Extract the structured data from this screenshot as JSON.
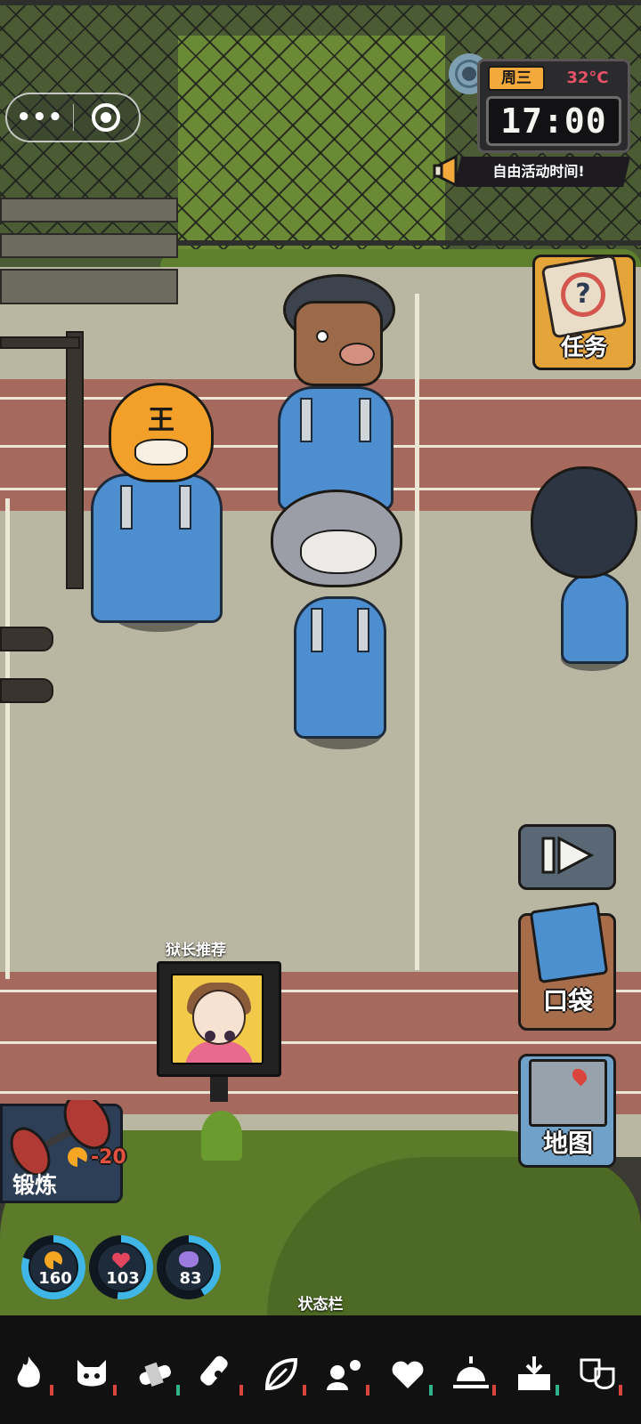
{
  "mini_program": {
    "menu_icon": "more-dots-icon",
    "menu_label": "•••",
    "close_icon": "target-circle-icon"
  },
  "clock": {
    "day": "周三",
    "temperature": "32°C",
    "time": "17:00",
    "settings_icon": "gear-icon"
  },
  "announcement": {
    "icon": "megaphone-icon",
    "text": "自由活动时间!"
  },
  "side_buttons": {
    "quest": {
      "label": "任务",
      "icon": "clipboard-question-icon"
    },
    "fast_forward": {
      "icon": "fast-forward-icon"
    },
    "pocket": {
      "label": "口袋",
      "icon": "pocket-card-icon"
    },
    "map": {
      "label": "地图",
      "icon": "map-icon"
    }
  },
  "recommendation": {
    "title": "狱长推荐",
    "icon": "recommended-game-art"
  },
  "exercise": {
    "label": "锻炼",
    "cost": "-20",
    "icon": "dumbbell-icon",
    "cost_icon": "stamina-icon"
  },
  "stats": [
    {
      "name": "stamina",
      "icon": "stamina-icon",
      "value": "160",
      "level": 0.8,
      "color": "#3fb6e6"
    },
    {
      "name": "health",
      "icon": "heart-icon",
      "value": "103",
      "level": 0.52,
      "color": "#3fb6e6"
    },
    {
      "name": "brain",
      "icon": "brain-icon",
      "value": "83",
      "level": 0.42,
      "color": "#3fb6e6"
    }
  ],
  "status_bar": {
    "title": "状态栏",
    "items": [
      {
        "icon": "fire-icon",
        "mark_color": "#d9443b"
      },
      {
        "icon": "cat-mask-icon",
        "mark_color": "#d9443b"
      },
      {
        "icon": "bandage-icon",
        "mark_color": "#2fb38a"
      },
      {
        "icon": "plaster-icon",
        "mark_color": "#d9443b"
      },
      {
        "icon": "leaf-icon",
        "mark_color": "#d9443b"
      },
      {
        "icon": "sun-person-icon",
        "mark_color": "#d9443b"
      },
      {
        "icon": "heart-hands-icon",
        "mark_color": "#2fb38a"
      },
      {
        "icon": "sunrise-icon",
        "mark_color": "#d9443b"
      },
      {
        "icon": "download-box-icon",
        "mark_color": "#2fb38a"
      },
      {
        "icon": "theater-masks-icon",
        "mark_color": "#d9443b"
      }
    ]
  },
  "characters": [
    {
      "name": "tiger-mask-inmate",
      "mask_text": "王"
    },
    {
      "name": "pig-mask-inmate"
    },
    {
      "name": "wolf-mask-inmate"
    },
    {
      "name": "shadow-inmate"
    }
  ]
}
